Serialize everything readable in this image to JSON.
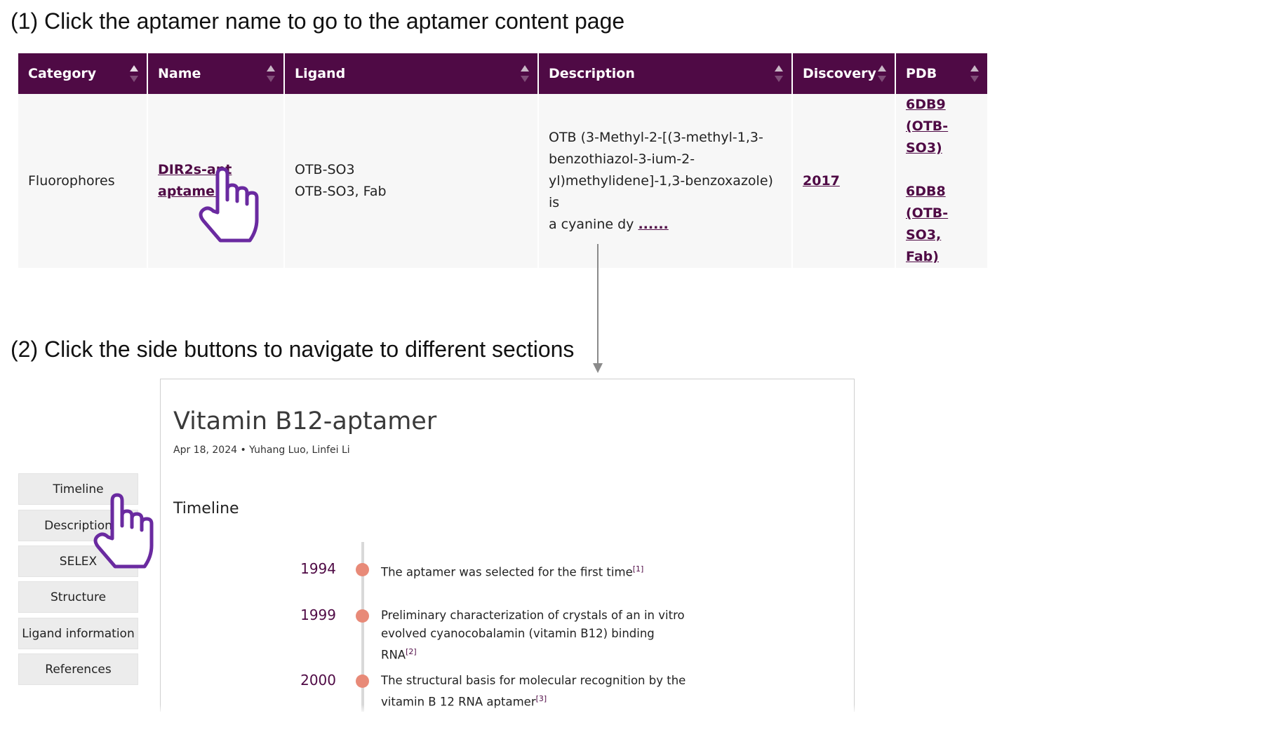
{
  "steps": {
    "step1": "(1) Click the aptamer name to go to the aptamer content page",
    "step2": "(2) Click the side buttons to navigate to different sections"
  },
  "table": {
    "headers": [
      "Category",
      "Name",
      "Ligand",
      "Description",
      "Discovery",
      "PDB"
    ],
    "row": {
      "category": "Fluorophores",
      "name_line1": "DIR2s-apt",
      "name_line2": "aptamer",
      "ligand_line1": "OTB-SO3",
      "ligand_line2": "OTB-SO3, Fab",
      "description_lines": [
        "OTB (3-Methyl-2-[(3-methyl-1,3-",
        "benzothiazol-3-ium-2-",
        "yl)methylidene]-1,3-benzoxazole) is",
        "a cyanine dy"
      ],
      "description_more": "......",
      "discovery": "2017",
      "pdb": [
        {
          "id": "6DB9",
          "detail_line1": "(OTB-SO3)",
          "detail_line2": ""
        },
        {
          "id": "6DB8",
          "detail_line1": "(OTB-SO3,",
          "detail_line2": "Fab)"
        }
      ]
    }
  },
  "article": {
    "title": "Vitamin B12-aptamer",
    "meta": "Apr 18, 2024 • Yuhang Luo, Linfei Li",
    "section": "Timeline",
    "timeline": [
      {
        "year": "1994",
        "text": "The aptamer was selected for the first time",
        "ref": "[1]"
      },
      {
        "year": "1999",
        "text": "Preliminary characterization of crystals of an in vitro evolved cyanocobalamin (vitamin B12) binding RNA",
        "ref": "[2]"
      },
      {
        "year": "2000",
        "text": "The structural basis for molecular recognition by the vitamin B 12 RNA aptamer",
        "ref": "[3]"
      }
    ]
  },
  "sidebar": {
    "items": [
      "Timeline",
      "Description",
      "SELEX",
      "Structure",
      "Ligand information",
      "References"
    ]
  },
  "colors": {
    "header_bg": "#4f0a45",
    "accent": "#4f0a45",
    "timeline_dot": "#e88a78",
    "hand_cursor": "#6a2aa0"
  },
  "icons": [
    "pointing-hand-icon",
    "sort-arrows-icon",
    "arrow-down-icon"
  ]
}
